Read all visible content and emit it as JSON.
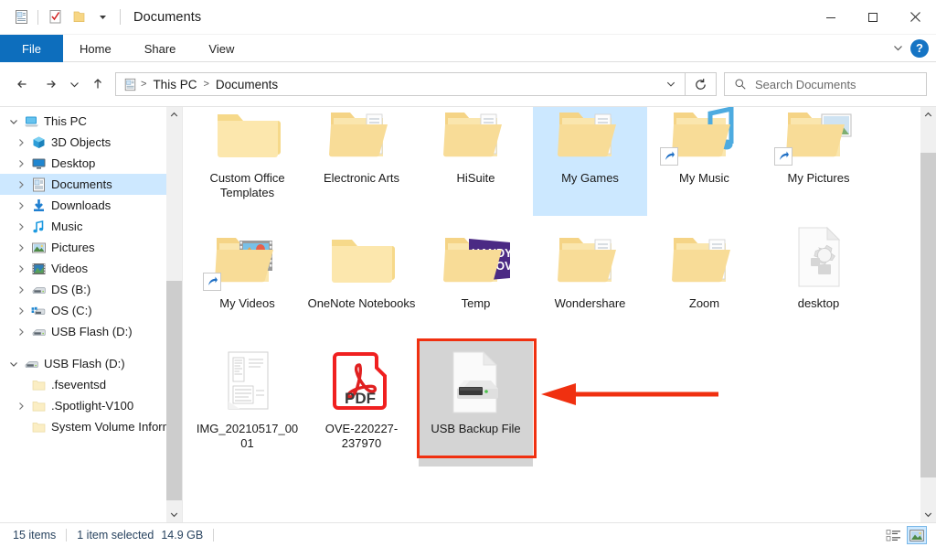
{
  "window": {
    "title": "Documents",
    "minimize_label": "Minimize",
    "maximize_label": "Maximize",
    "close_label": "Close"
  },
  "quick_access": {
    "items": [
      {
        "name": "documents-icon",
        "label": "Documents properties"
      },
      {
        "name": "properties-icon",
        "label": "Properties"
      },
      {
        "name": "new-folder-icon",
        "label": "New folder"
      },
      {
        "name": "customize-dropdown-icon",
        "label": "Customize Quick Access Toolbar"
      }
    ]
  },
  "ribbon": {
    "tabs": [
      {
        "label": "File",
        "active": true
      },
      {
        "label": "Home",
        "active": false
      },
      {
        "label": "Share",
        "active": false
      },
      {
        "label": "View",
        "active": false
      }
    ],
    "collapse_label": "Minimize the Ribbon",
    "help_label": "?"
  },
  "address": {
    "back_label": "Back",
    "forward_label": "Forward",
    "recent_label": "Recent locations",
    "up_label": "Up",
    "crumbs": [
      "This PC",
      "Documents"
    ],
    "separator": ">",
    "dropdown_label": "Previous locations",
    "refresh_label": "Refresh"
  },
  "search": {
    "placeholder": "Search Documents",
    "value": "",
    "icon": "search-icon"
  },
  "sidebar": {
    "items": [
      {
        "label": "This PC",
        "icon": "pc-icon",
        "chevron": "expanded",
        "indent": 0,
        "selected": false
      },
      {
        "label": "3D Objects",
        "icon": "3d-objects-icon",
        "chevron": "collapsed",
        "indent": 1,
        "selected": false
      },
      {
        "label": "Desktop",
        "icon": "desktop-icon",
        "chevron": "collapsed",
        "indent": 1,
        "selected": false
      },
      {
        "label": "Documents",
        "icon": "documents-icon",
        "chevron": "collapsed",
        "indent": 1,
        "selected": true
      },
      {
        "label": "Downloads",
        "icon": "downloads-icon",
        "chevron": "collapsed",
        "indent": 1,
        "selected": false
      },
      {
        "label": "Music",
        "icon": "music-icon",
        "chevron": "collapsed",
        "indent": 1,
        "selected": false
      },
      {
        "label": "Pictures",
        "icon": "pictures-icon",
        "chevron": "collapsed",
        "indent": 1,
        "selected": false
      },
      {
        "label": "Videos",
        "icon": "videos-icon",
        "chevron": "collapsed",
        "indent": 1,
        "selected": false
      },
      {
        "label": "DS (B:)",
        "icon": "drive-icon",
        "chevron": "collapsed",
        "indent": 1,
        "selected": false
      },
      {
        "label": "OS (C:)",
        "icon": "windows-drive-icon",
        "chevron": "collapsed",
        "indent": 1,
        "selected": false
      },
      {
        "label": "USB Flash (D:)",
        "icon": "usb-drive-icon",
        "chevron": "collapsed",
        "indent": 1,
        "selected": false
      },
      {
        "label": "",
        "icon": "spacer",
        "chevron": "none",
        "indent": 0,
        "selected": false
      },
      {
        "label": "USB Flash (D:)",
        "icon": "usb-drive-icon",
        "chevron": "expanded",
        "indent": 0,
        "selected": false
      },
      {
        "label": ".fseventsd",
        "icon": "folder-icon",
        "chevron": "none",
        "indent": 1,
        "selected": false
      },
      {
        "label": ".Spotlight-V100",
        "icon": "folder-icon",
        "chevron": "collapsed",
        "indent": 1,
        "selected": false
      },
      {
        "label": "System Volume Inform",
        "icon": "folder-icon",
        "chevron": "none",
        "indent": 1,
        "selected": false
      }
    ]
  },
  "files": [
    {
      "name": "Custom Office Templates",
      "icon": "folder-plain-icon",
      "selected": false,
      "shortcut": false,
      "highlighted": false
    },
    {
      "name": "Electronic Arts",
      "icon": "folder-docs-icon",
      "selected": false,
      "shortcut": false,
      "highlighted": false
    },
    {
      "name": "HiSuite",
      "icon": "folder-docs-icon",
      "selected": false,
      "shortcut": false,
      "highlighted": false
    },
    {
      "name": "My Games",
      "icon": "folder-docs-icon",
      "selected": true,
      "shortcut": false,
      "highlighted": false
    },
    {
      "name": "My Music",
      "icon": "folder-music-icon",
      "selected": false,
      "shortcut": true,
      "highlighted": false
    },
    {
      "name": "My Pictures",
      "icon": "folder-pictures-icon",
      "selected": false,
      "shortcut": true,
      "highlighted": false
    },
    {
      "name": "My Videos",
      "icon": "folder-videos-icon",
      "selected": false,
      "shortcut": true,
      "highlighted": false
    },
    {
      "name": "OneNote Notebooks",
      "icon": "folder-plain-icon",
      "selected": false,
      "shortcut": false,
      "highlighted": false
    },
    {
      "name": "Temp",
      "icon": "folder-handy-recovery-icon",
      "selected": false,
      "shortcut": false,
      "highlighted": false
    },
    {
      "name": "Wondershare",
      "icon": "folder-docs-icon",
      "selected": false,
      "shortcut": false,
      "highlighted": false
    },
    {
      "name": "Zoom",
      "icon": "folder-docs-icon",
      "selected": false,
      "shortcut": false,
      "highlighted": false
    },
    {
      "name": "desktop",
      "icon": "config-file-icon",
      "selected": false,
      "shortcut": false,
      "highlighted": false
    },
    {
      "name": "IMG_20210517_0001",
      "icon": "image-thumbnail-icon",
      "selected": false,
      "shortcut": false,
      "highlighted": false
    },
    {
      "name": "OVE-220227-237970",
      "icon": "pdf-file-icon",
      "selected": false,
      "shortcut": false,
      "highlighted": false
    },
    {
      "name": "USB Backup File",
      "icon": "drive-backup-file-icon",
      "selected": false,
      "shortcut": false,
      "highlighted": true
    }
  ],
  "annotation": {
    "highlight_color": "#f03010",
    "arrow_label": "pointer-to-usb-backup-file"
  },
  "status": {
    "item_count": "15 items",
    "selection": "1 item selected",
    "size": "14.9 GB",
    "view_details_label": "Details view",
    "view_large_icons_label": "Large icons view"
  }
}
